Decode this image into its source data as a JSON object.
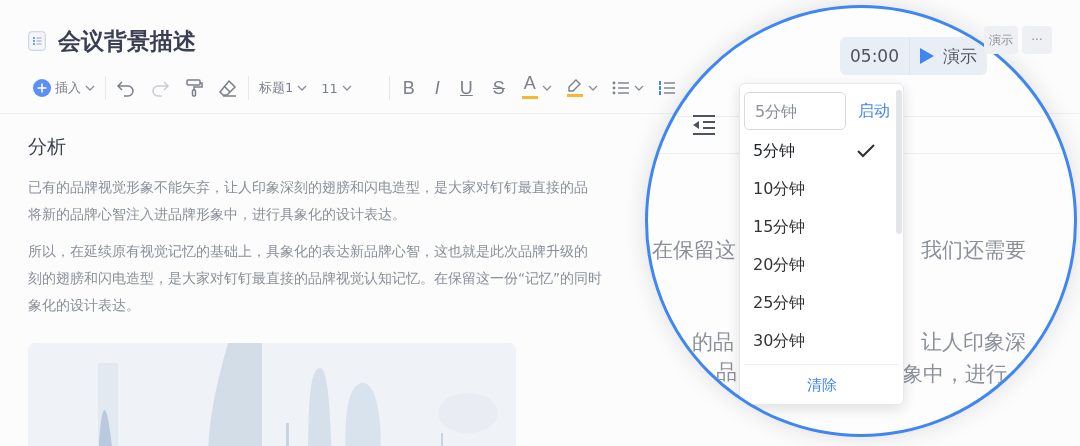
{
  "document": {
    "title": "会议背景描述"
  },
  "toolbar": [
    {
      "kind": "insert",
      "label": "插入"
    },
    {
      "kind": "divider"
    },
    {
      "kind": "undo",
      "disabled": false
    },
    {
      "kind": "redo",
      "disabled": true
    },
    {
      "kind": "painter"
    },
    {
      "kind": "eraser"
    },
    {
      "kind": "divider"
    },
    {
      "kind": "select",
      "label": "标题1"
    },
    {
      "kind": "select",
      "label": "11"
    },
    {
      "kind": "divider"
    },
    {
      "kind": "bold",
      "label": "B"
    },
    {
      "kind": "italic",
      "label": "I"
    },
    {
      "kind": "underline",
      "label": "U"
    },
    {
      "kind": "strike",
      "label": "S"
    },
    {
      "kind": "font-color",
      "label": "A",
      "color": "#f5b82e"
    },
    {
      "kind": "highlight",
      "color": "#f5b82e"
    },
    {
      "kind": "bullets"
    },
    {
      "kind": "numbered"
    }
  ],
  "top_actions": [
    {
      "kind": "text",
      "label": "演示"
    },
    {
      "kind": "more",
      "label": "···"
    }
  ],
  "content": {
    "heading": "分析",
    "paragraphs": [
      {
        "lines": [
          "已有的品牌视觉形象不能矢弃，让人印象深刻的翅膀和闪电造型，是大家对钉钉最直接的品",
          "将新的品牌心智注入进品牌形象中，进行具象化的设计表达。"
        ]
      },
      {
        "lines": [
          "所以，在延续原有视觉记忆的基础上，具象化的表达新品牌心智，这也就是此次品牌升级的",
          "刻的翅膀和闪电造型，是大家对钉钉最直接的品牌视觉认知记忆。在保留这一份“记忆”的同时",
          "象化的设计表达。"
        ]
      }
    ]
  },
  "magnifier": {
    "timer": {
      "time": "05:00",
      "play_label": "演示"
    },
    "background_text": [
      "在保留这",
      "我们还需要",
      "的品",
      "让人印象深",
      "品",
      "象中，进行"
    ],
    "timer_menu": {
      "placeholder": "5分钟",
      "start": "启动",
      "options": [
        {
          "label": "5分钟",
          "selected": true
        },
        {
          "label": "10分钟",
          "selected": false
        },
        {
          "label": "15分钟",
          "selected": false
        },
        {
          "label": "20分钟",
          "selected": false
        },
        {
          "label": "25分钟",
          "selected": false
        },
        {
          "label": "30分钟",
          "selected": false
        }
      ],
      "clear": "清除"
    }
  }
}
